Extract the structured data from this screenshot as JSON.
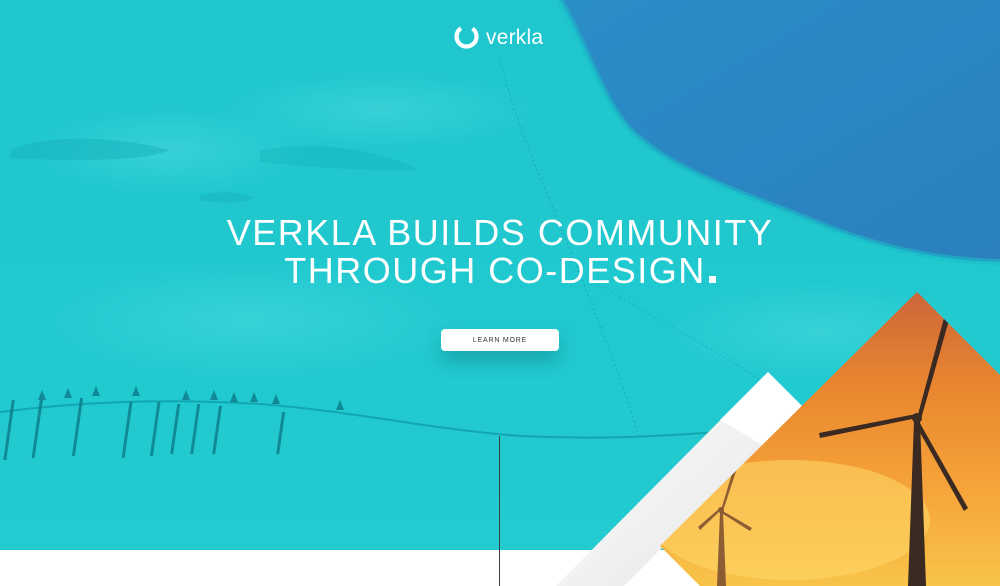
{
  "brand": {
    "name": "verkla",
    "accent": "#1fc6cd",
    "deep_blue": "#2b82bf",
    "sunset_orange": "#f3a23a"
  },
  "hero": {
    "headline_lines": [
      "VERKLA BUILDS COMMUNITY",
      "THROUGH CO-DESIGN"
    ],
    "cta_label": "LEARN MORE"
  },
  "icons": {
    "logo": "ring-logo-icon",
    "turbine": "wind-turbine-icon"
  }
}
